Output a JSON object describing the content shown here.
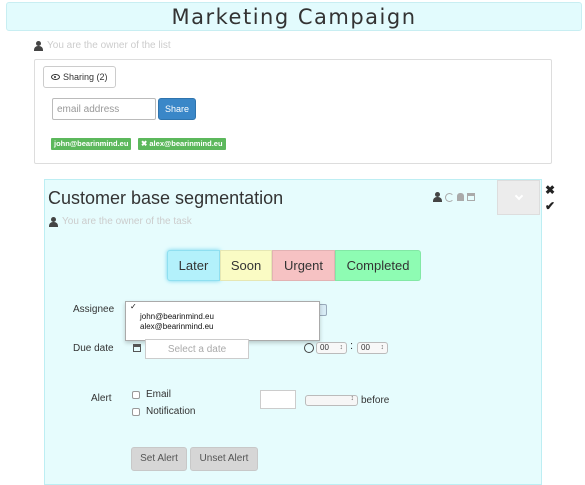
{
  "list": {
    "title": "Marketing Campaign",
    "owner_text": "You are the owner of the list"
  },
  "sharing": {
    "tab_label": "Sharing (2)",
    "email_placeholder": "email address",
    "share_button": "Share",
    "shared_with": [
      "john@bearinmind.eu",
      "alex@bearinmind.eu"
    ],
    "tag_color": "#5cb85c"
  },
  "task": {
    "title": "Customer base segmentation",
    "owner_text": "You are the owner of the task",
    "statuses": [
      {
        "label": "Later",
        "color": "#b3f1fb",
        "active": true
      },
      {
        "label": "Soon",
        "color": "#fafbc4",
        "active": false
      },
      {
        "label": "Urgent",
        "color": "#f6c2c3",
        "active": false
      },
      {
        "label": "Completed",
        "color": "#8efcb3",
        "active": false
      }
    ],
    "assignee_label": "Assignee",
    "assignee_options": [
      "john@bearinmind.eu",
      "alex@bearinmind.eu"
    ],
    "due_date_label": "Due date",
    "date_placeholder": "Select a date",
    "hour": "00",
    "minute": "00",
    "alert_label": "Alert",
    "alert_email": "Email",
    "alert_notification": "Notification",
    "before_label": "before",
    "set_alert": "Set Alert",
    "unset_alert": "Unset Alert"
  },
  "side": {
    "close_glyph": "✖",
    "check_glyph": "✔"
  }
}
